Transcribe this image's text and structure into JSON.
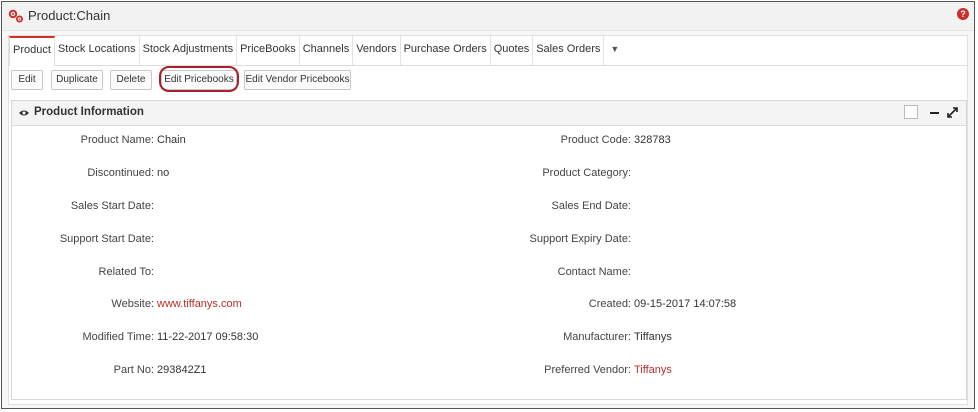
{
  "window": {
    "title": "Product:Chain",
    "help_glyph": "?"
  },
  "tabs": [
    {
      "label": "Product",
      "active": true
    },
    {
      "label": "Stock Locations"
    },
    {
      "label": "Stock Adjustments"
    },
    {
      "label": "PriceBooks"
    },
    {
      "label": "Channels"
    },
    {
      "label": "Vendors"
    },
    {
      "label": "Purchase Orders"
    },
    {
      "label": "Quotes"
    },
    {
      "label": "Sales Orders"
    }
  ],
  "toolbar": {
    "edit": "Edit",
    "duplicate": "Duplicate",
    "delete": "Delete",
    "edit_pricebooks": "Edit Pricebooks",
    "edit_vendor_pricebooks": "Edit Vendor Pricebooks"
  },
  "panel": {
    "title": "Product Information"
  },
  "fields": {
    "left": [
      {
        "label": "Product Name:",
        "value": "Chain"
      },
      {
        "label": "Discontinued:",
        "value": "no"
      },
      {
        "label": "Sales Start Date:",
        "value": ""
      },
      {
        "label": "Support Start Date:",
        "value": ""
      },
      {
        "label": "Related To:",
        "value": ""
      },
      {
        "label": "Website:",
        "value": "www.tiffanys.com"
      },
      {
        "label": "Modified Time:",
        "value": "11-22-2017 09:58:30"
      },
      {
        "label": "Part No:",
        "value": "293842Z1"
      }
    ],
    "right": [
      {
        "label": "Product Code:",
        "value": "328783"
      },
      {
        "label": "Product Category:",
        "value": ""
      },
      {
        "label": "Sales End Date:",
        "value": ""
      },
      {
        "label": "Support Expiry Date:",
        "value": ""
      },
      {
        "label": "Contact Name:",
        "value": ""
      },
      {
        "label": "Created:",
        "value": "09-15-2017 14:07:58"
      },
      {
        "label": "Manufacturer:",
        "value": "Tiffanys"
      },
      {
        "label": "Preferred Vendor:",
        "value": "Tiffanys"
      }
    ]
  },
  "colors": {
    "accent": "#c9302c",
    "link": "#b5302a",
    "highlight_ring": "#a8202a"
  }
}
